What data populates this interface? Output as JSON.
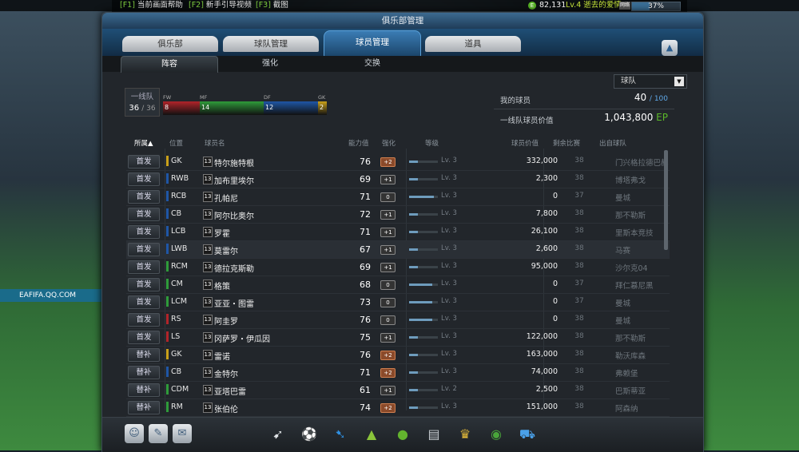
{
  "topbar": {
    "hotkeys": [
      {
        "key": "[F1]",
        "label": "当前画面帮助"
      },
      {
        "key": "[F2]",
        "label": "新手引导视频"
      },
      {
        "key": "[F3]",
        "label": "截图"
      }
    ],
    "ep_icon": "E",
    "ep": "82,131",
    "level": "Lv.4 逝去的爱情",
    "net_label": "网络",
    "battery": "37%"
  },
  "window": {
    "title": "俱乐部管理",
    "tabs": [
      "俱乐部",
      "球队管理",
      "球员管理",
      "道具"
    ],
    "active_tab": 2,
    "subtabs": [
      "阵容",
      "强化",
      "交换"
    ],
    "active_subtab": 0,
    "up_icon": "▲",
    "filter": {
      "value": "球队",
      "arrow": "▼"
    }
  },
  "squad": {
    "label": "一线队",
    "count": "36",
    "total": "/ 36",
    "positions": [
      {
        "code": "FW",
        "count": "8",
        "color": "#b1242a"
      },
      {
        "code": "MF",
        "count": "14",
        "color": "#2f9b3a"
      },
      {
        "code": "DF",
        "count": "12",
        "color": "#1f56a6"
      },
      {
        "code": "GK",
        "count": "2",
        "color": "#c9a01a"
      }
    ]
  },
  "summary": {
    "my_players_label": "我的球员",
    "my_players": "40",
    "my_players_max": "/ 100",
    "value_label": "一线队球员价值",
    "value": "1,043,800",
    "value_unit": "EP"
  },
  "table": {
    "headers": {
      "slot": "所属▲",
      "pos": "位置",
      "name": "球员名",
      "ovr": "能力值",
      "enhance": "强化",
      "level": "等级",
      "price": "球员价值",
      "remaining": "剩余比赛",
      "club": "出自球队"
    },
    "season_badge": "13",
    "rows": [
      {
        "slot": "首发",
        "pos": "GK",
        "color": "#c9a01a",
        "name": "特尔施特根",
        "ovr": "76",
        "enh": "+2",
        "lv": "Lv. 3",
        "lvfill": 0.3,
        "price": "332,000",
        "remain": "38",
        "club": "门兴格拉德巴赫"
      },
      {
        "slot": "首发",
        "pos": "RWB",
        "color": "#1f56a6",
        "name": "加布里埃尔",
        "ovr": "69",
        "enh": "+1",
        "lv": "Lv. 3",
        "lvfill": 0.3,
        "price": "2,300",
        "remain": "38",
        "club": "博塔弗戈"
      },
      {
        "slot": "首发",
        "pos": "RCB",
        "color": "#1f56a6",
        "name": "孔帕尼",
        "ovr": "71",
        "enh": "0",
        "lv": "Lv. 3",
        "lvfill": 0.85,
        "price": "0",
        "remain": "37",
        "club": "曼城"
      },
      {
        "slot": "首发",
        "pos": "CB",
        "color": "#1f56a6",
        "name": "阿尔比奥尔",
        "ovr": "72",
        "enh": "+1",
        "lv": "Lv. 3",
        "lvfill": 0.3,
        "price": "7,800",
        "remain": "38",
        "club": "那不勒斯"
      },
      {
        "slot": "首发",
        "pos": "LCB",
        "color": "#1f56a6",
        "name": "罗霍",
        "ovr": "71",
        "enh": "+1",
        "lv": "Lv. 3",
        "lvfill": 0.3,
        "price": "26,100",
        "remain": "38",
        "club": "里斯本竞技"
      },
      {
        "slot": "首发",
        "pos": "LWB",
        "color": "#1f56a6",
        "name": "莫雷尔",
        "ovr": "67",
        "enh": "+1",
        "lv": "Lv. 3",
        "lvfill": 0.3,
        "price": "2,600",
        "remain": "38",
        "club": "马赛"
      },
      {
        "slot": "首发",
        "pos": "RCM",
        "color": "#2f9b3a",
        "name": "德拉克斯勒",
        "ovr": "69",
        "enh": "+1",
        "lv": "Lv. 3",
        "lvfill": 0.3,
        "price": "95,000",
        "remain": "38",
        "club": "沙尔克04"
      },
      {
        "slot": "首发",
        "pos": "CM",
        "color": "#2f9b3a",
        "name": "格策",
        "ovr": "68",
        "enh": "0",
        "lv": "Lv. 3",
        "lvfill": 0.8,
        "price": "0",
        "remain": "37",
        "club": "拜仁慕尼黑"
      },
      {
        "slot": "首发",
        "pos": "LCM",
        "color": "#2f9b3a",
        "name": "亚亚・图雷",
        "ovr": "73",
        "enh": "0",
        "lv": "Lv. 3",
        "lvfill": 0.8,
        "price": "0",
        "remain": "37",
        "club": "曼城"
      },
      {
        "slot": "首发",
        "pos": "RS",
        "color": "#b1242a",
        "name": "阿圭罗",
        "ovr": "76",
        "enh": "0",
        "lv": "Lv. 3",
        "lvfill": 0.8,
        "price": "0",
        "remain": "38",
        "club": "曼城"
      },
      {
        "slot": "首发",
        "pos": "LS",
        "color": "#b1242a",
        "name": "冈萨罗・伊瓜因",
        "ovr": "75",
        "enh": "+1",
        "lv": "Lv. 3",
        "lvfill": 0.3,
        "price": "122,000",
        "remain": "38",
        "club": "那不勒斯"
      },
      {
        "slot": "替补",
        "pos": "GK",
        "color": "#c9a01a",
        "name": "雷诺",
        "ovr": "76",
        "enh": "+2",
        "lv": "Lv. 3",
        "lvfill": 0.3,
        "price": "163,000",
        "remain": "38",
        "club": "勒沃库森"
      },
      {
        "slot": "替补",
        "pos": "CB",
        "color": "#1f56a6",
        "name": "金特尔",
        "ovr": "71",
        "enh": "+2",
        "lv": "Lv. 3",
        "lvfill": 0.3,
        "price": "74,000",
        "remain": "38",
        "club": "弗赖堡"
      },
      {
        "slot": "替补",
        "pos": "CDM",
        "color": "#2f9b3a",
        "name": "亚塔巴雷",
        "ovr": "61",
        "enh": "+1",
        "lv": "Lv. 2",
        "lvfill": 0.3,
        "price": "2,500",
        "remain": "38",
        "club": "巴斯蒂亚"
      },
      {
        "slot": "替补",
        "pos": "RM",
        "color": "#2f9b3a",
        "name": "张伯伦",
        "ovr": "74",
        "enh": "+2",
        "lv": "Lv. 3",
        "lvfill": 0.3,
        "price": "151,000",
        "remain": "38",
        "club": "阿森纳"
      }
    ]
  },
  "background": {
    "ad_text": "EAFIFA.QQ.COM"
  },
  "bottombar": {
    "social": [
      {
        "name": "profile-icon",
        "glyph": "☺"
      },
      {
        "name": "chat-icon",
        "glyph": "✎"
      },
      {
        "name": "mail-icon",
        "glyph": "✉"
      }
    ],
    "menu": [
      {
        "name": "boots-icon",
        "glyph": "➹",
        "color": "#dfe3e6"
      },
      {
        "name": "ball-icon",
        "glyph": "⚽",
        "color": "#e23b2f"
      },
      {
        "name": "cleats-icon",
        "glyph": "➷",
        "color": "#2f8fe0"
      },
      {
        "name": "ranking-icon",
        "glyph": "▲",
        "color": "#8ac43a"
      },
      {
        "name": "worldcup-icon",
        "glyph": "●",
        "color": "#63b32e"
      },
      {
        "name": "cards-icon",
        "glyph": "▤",
        "color": "#c7ccd1"
      },
      {
        "name": "jersey-icon",
        "glyph": "♛",
        "color": "#e0b83a"
      },
      {
        "name": "club-icon",
        "glyph": "◉",
        "color": "#49a53a"
      },
      {
        "name": "cart-icon",
        "glyph": "⛟",
        "color": "#4aa0e8"
      }
    ]
  }
}
